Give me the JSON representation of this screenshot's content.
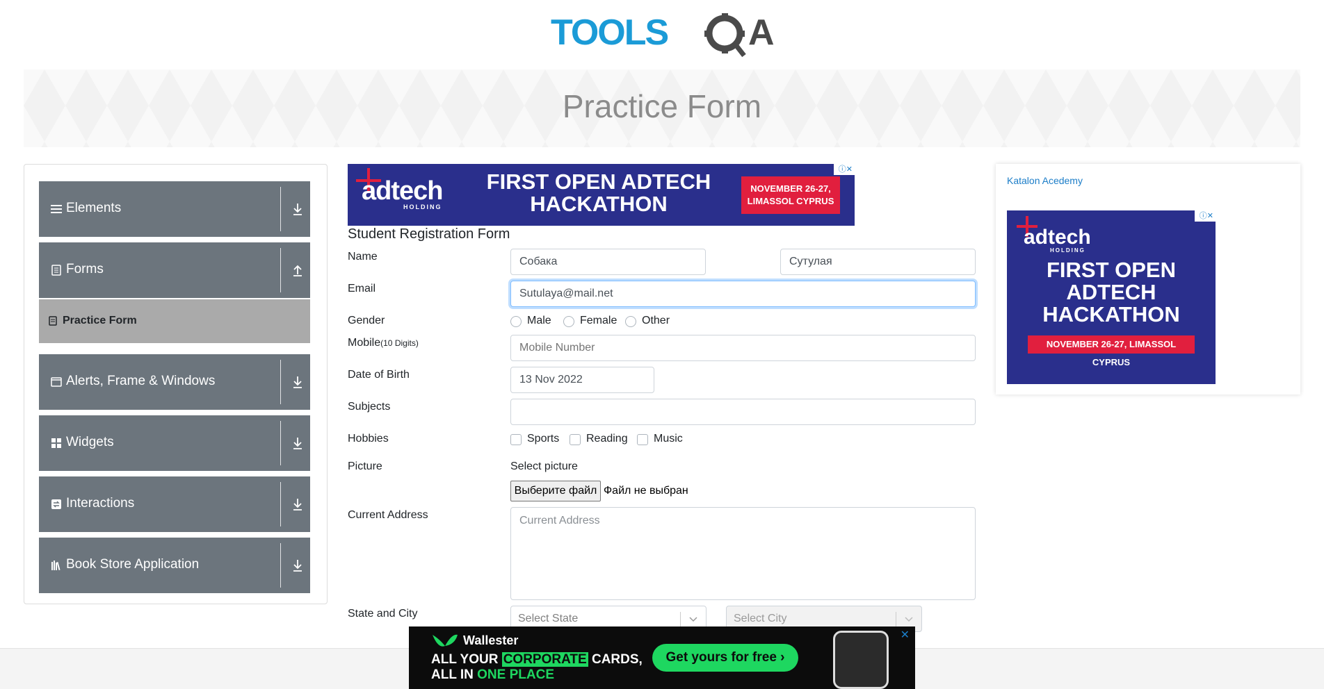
{
  "header": {
    "logo_text": "TOOLSQA",
    "page_title": "Practice Form"
  },
  "sidebar": {
    "groups": [
      {
        "label": "Elements",
        "icon": "hamburger-icon",
        "arrow": "down"
      },
      {
        "label": "Forms",
        "icon": "document-icon",
        "arrow": "up"
      },
      {
        "label": "Alerts, Frame & Windows",
        "icon": "window-icon",
        "arrow": "down"
      },
      {
        "label": "Widgets",
        "icon": "widgets-icon",
        "arrow": "down"
      },
      {
        "label": "Interactions",
        "icon": "interactions-icon",
        "arrow": "down"
      },
      {
        "label": "Book Store Application",
        "icon": "books-icon",
        "arrow": "down"
      }
    ],
    "active_item": "Practice Form"
  },
  "ad_top": {
    "brand": "adtech",
    "brand_sub": "HOLDING",
    "headline": "FIRST OPEN ADTECH HACKATHON",
    "badge": "NOVEMBER 26-27, LIMASSOL CYPRUS"
  },
  "form": {
    "title": "Student Registration Form",
    "name_label": "Name",
    "first_name": "Собака",
    "last_name": "Сутулая",
    "email_label": "Email",
    "email": "Sutulaya@mail.net",
    "gender_label": "Gender",
    "gender_options": [
      "Male",
      "Female",
      "Other"
    ],
    "mobile_label": "Mobile",
    "mobile_hint": "(10 Digits)",
    "mobile_placeholder": "Mobile Number",
    "dob_label": "Date of Birth",
    "dob": "13 Nov 2022",
    "subjects_label": "Subjects",
    "subjects_value": "",
    "hobbies_label": "Hobbies",
    "hobbies_options": [
      "Sports",
      "Reading",
      "Music"
    ],
    "picture_label": "Picture",
    "select_picture": "Select picture",
    "file_button": "Выберите файл",
    "file_status": "Файл не выбран",
    "address_label": "Current Address",
    "address_placeholder": "Current Address",
    "state_city_label": "State and City",
    "state_placeholder": "Select State",
    "city_placeholder": "Select City"
  },
  "right_ad": {
    "alt_text": "Katalon Acedemy",
    "brand": "adtech",
    "brand_sub": "HOLDING",
    "headline": "FIRST OPEN ADTECH HACKATHON",
    "badge": "NOVEMBER 26-27, LIMASSOL CYPRUS"
  },
  "bottom_ad": {
    "brand": "Wallester",
    "line1_pre": "ALL YOUR ",
    "line1_hl": "CORPORATE",
    "line1_post": " CARDS,",
    "line2_pre": "ALL IN ",
    "line2_hl": "ONE PLACE",
    "cta": "Get yours for free ›"
  },
  "colors": {
    "sidebar_group_bg": "#6c757d",
    "sidebar_active_bg": "#aaaaaa",
    "logo_blue": "#1b9bd7",
    "ad_bg": "#2a2f8c",
    "ad_red": "#e11f3e",
    "wallester_green": "#1ed760"
  }
}
